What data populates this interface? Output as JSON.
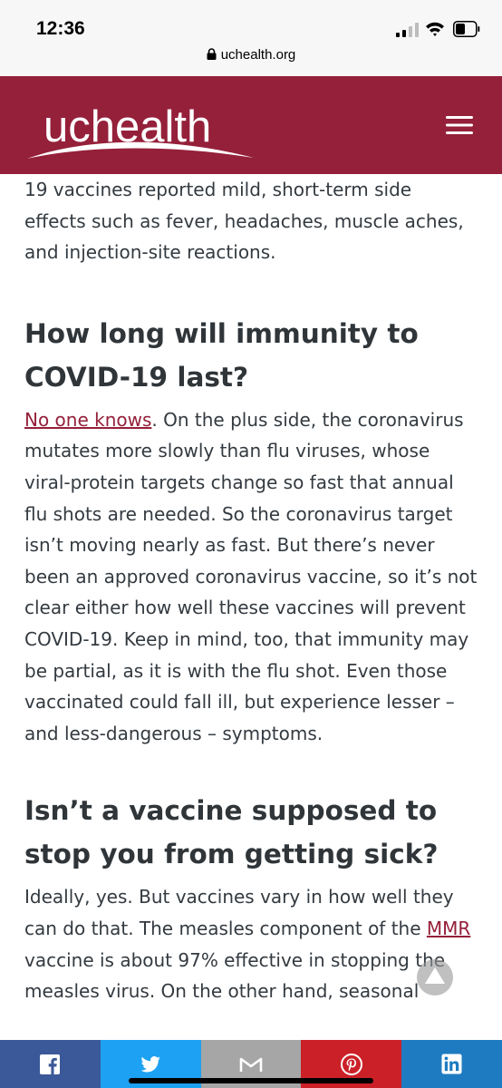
{
  "status_bar": {
    "time": "12:36",
    "url": "uchealth.org",
    "icons": [
      "cellular-signal-icon",
      "wifi-icon",
      "battery-icon",
      "lock-icon"
    ]
  },
  "header": {
    "logo_text": "uchealth",
    "menu_icon": "hamburger-menu-icon",
    "brand_color": "#95203a"
  },
  "article": {
    "intro_fragment": "19 vaccines reported mild, short-term side effects such as fever, headaches, muscle aches, and injection-site reactions.",
    "section1": {
      "heading": "How long will immunity to COVID-19 last?",
      "link_text": "No one knows",
      "body": ". On the plus side, the coronavirus mutates more slowly than flu viruses, whose viral-protein targets change so fast that annual flu shots are needed. So the coronavirus target isn’t moving nearly as fast. But there’s never been an approved coronavirus vaccine, so it’s not clear either how well these vaccines will prevent COVID-19. Keep in mind, too, that immunity may be partial, as it is with the flu shot. Even those vaccinated could fall ill, but experience lesser – and less-dangerous – symptoms."
    },
    "section2": {
      "heading": "Isn’t a vaccine supposed to stop you from getting sick?",
      "body_a": "Ideally, yes. But vaccines vary in how well they can do that. The measles component of the ",
      "link_text": "MMR",
      "body_b": " vaccine is about 97% effective in stopping the measles virus. On the other hand, seasonal"
    }
  },
  "scroll_top_icon": "arrow-up-icon",
  "share_bar": [
    {
      "name": "facebook",
      "icon": "facebook-icon",
      "color": "#3b5998"
    },
    {
      "name": "twitter",
      "icon": "twitter-icon",
      "color": "#1da1f2"
    },
    {
      "name": "email",
      "icon": "mail-icon",
      "color": "#a6a6a6"
    },
    {
      "name": "pinterest",
      "icon": "pinterest-icon",
      "color": "#cb2027"
    },
    {
      "name": "linkedin",
      "icon": "linkedin-icon",
      "color": "#1f7bc1"
    }
  ]
}
